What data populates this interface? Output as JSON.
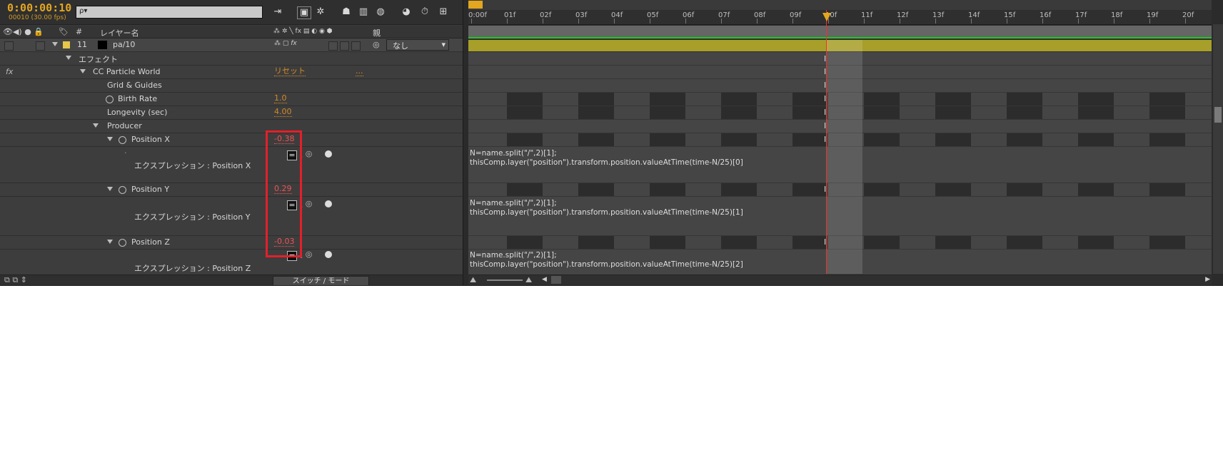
{
  "timecode": "0:00:00:10",
  "frames_info": "00010 (30.00 fps)",
  "search": {
    "placeholder": "ρ▾"
  },
  "header": {
    "icons": "👁◀) ● 🔒",
    "label_col": "🏷",
    "num_col": "#",
    "layer_name_col": "レイヤー名",
    "switches_col": "⁂ ✲ ╲ fx ▤ ◐ ◉ ⬢",
    "parent_col": "親"
  },
  "layer": {
    "number": "11",
    "name": "pa/10",
    "label_color": "#e6c84a",
    "parent_value": "なし"
  },
  "rows": {
    "effect": "エフェクト",
    "fx_symbol": "fx",
    "plugin": "CC Particle World",
    "reset": "リセット",
    "dots": "...",
    "grid": "Grid & Guides",
    "birth_rate": "Birth Rate",
    "birth_rate_val": "1.0",
    "longevity": "Longevity (sec)",
    "longevity_val": "4.00",
    "producer": "Producer",
    "posx": "Position X",
    "posx_val": "-0.38",
    "expr_x": "エクスプレッション : Position X",
    "posy": "Position Y",
    "posy_val": "0.29",
    "expr_y": "エクスプレッション : Position Y",
    "posz": "Position Z",
    "posz_val": "-0.03",
    "expr_z": "エクスプレッション : Position Z"
  },
  "switch_mode_label": "スイッチ / モード",
  "ruler_ticks": [
    "0:00f",
    "01f",
    "02f",
    "03f",
    "04f",
    "05f",
    "06f",
    "07f",
    "08f",
    "09f",
    "10f",
    "11f",
    "12f",
    "13f",
    "14f",
    "15f",
    "16f",
    "17f",
    "18f",
    "19f",
    "20f"
  ],
  "expressions": {
    "x": [
      "N=name.split(\"/\",2)[1];",
      "thisComp.layer(\"position\").transform.position.valueAtTime(time-N/25)[0]"
    ],
    "y": [
      "N=name.split(\"/\",2)[1];",
      "thisComp.layer(\"position\").transform.position.valueAtTime(time-N/25)[1]"
    ],
    "z": [
      "N=name.split(\"/\",2)[1];",
      "thisComp.layer(\"position\").transform.position.valueAtTime(time-N/25)[2]"
    ]
  },
  "colors": {
    "accent": "#e3a61f",
    "highlight": "#e3202a",
    "work_area_green": "#22c728",
    "layer_bar": "#a89f2a"
  }
}
